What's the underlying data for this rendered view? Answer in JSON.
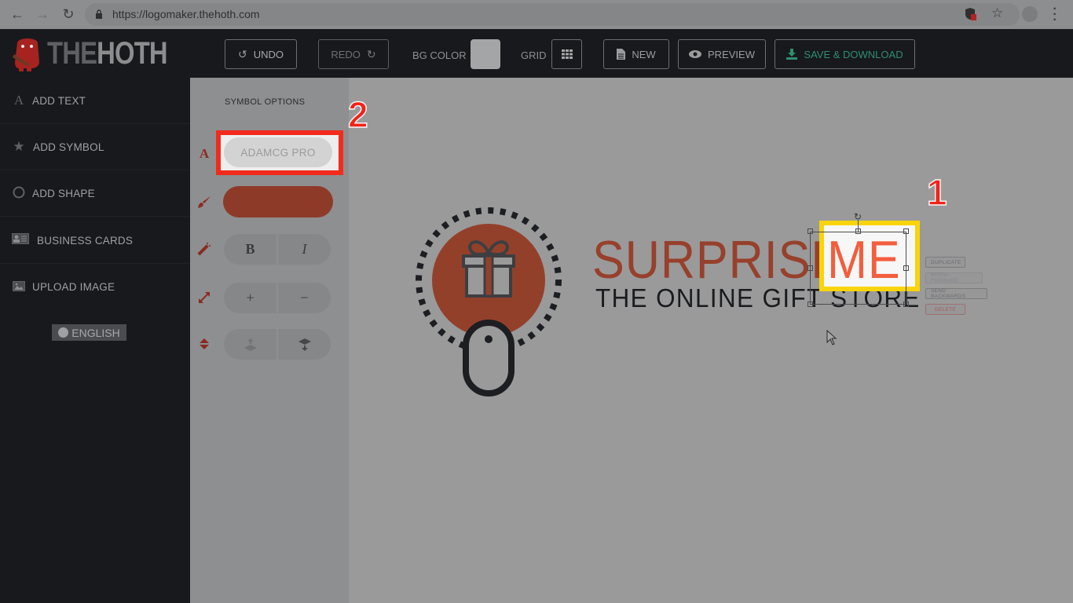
{
  "browser": {
    "url": "https://logomaker.thehoth.com",
    "back_icon": "arrow-left-icon",
    "forward_icon": "arrow-right-icon",
    "reload_icon": "reload-icon",
    "lock_icon": "lock-icon",
    "extension_icon": "shield-blocked-icon",
    "bookmark_icon": "star-icon",
    "profile_icon": "profile-avatar-icon",
    "menu_icon": "kebab-menu-icon"
  },
  "header": {
    "brand_the": "THE",
    "brand_hoth": "HOTH",
    "undo_label": "UNDO",
    "redo_label": "REDO",
    "bg_color_label": "BG COLOR",
    "bg_color_value": "#a4a5a6",
    "grid_label": "GRID",
    "new_label": "NEW",
    "preview_label": "PREVIEW",
    "save_label": "SAVE & DOWNLOAD"
  },
  "sidebar": {
    "items": [
      {
        "label": "ADD TEXT",
        "icon": "A"
      },
      {
        "label": "ADD SYMBOL",
        "icon": "★"
      },
      {
        "label": "ADD SHAPE",
        "icon": "○"
      },
      {
        "label": "BUSINESS CARDS",
        "icon": "id-card"
      },
      {
        "label": "UPLOAD IMAGE",
        "icon": "image"
      }
    ],
    "language": "ENGLISH"
  },
  "panel": {
    "title": "SYMBOL OPTIONS",
    "font_value": "ADAMCG PRO",
    "color_value": "#8e3a28",
    "bold_label": "B",
    "italic_label": "I",
    "increase_label": "+",
    "decrease_label": "−"
  },
  "canvas": {
    "brand_name": "SURPRISE",
    "brand_name_selected": "ME",
    "tagline": "THE ONLINE GIFT STORE",
    "context_menu": {
      "duplicate": "DUPLICATE",
      "bring_forward": "BRING FORWARD",
      "send_backwards": "SEND BACKWARDS",
      "delete": "DELETE"
    },
    "colors": {
      "primary": "#97402c",
      "selected_text": "#f25e3e",
      "tagline": "#1a1b1e"
    }
  },
  "annotations": {
    "marker_1": "1",
    "marker_2": "2",
    "highlight_1_color": "#f9d40a",
    "highlight_2_color": "#f12b1d"
  }
}
